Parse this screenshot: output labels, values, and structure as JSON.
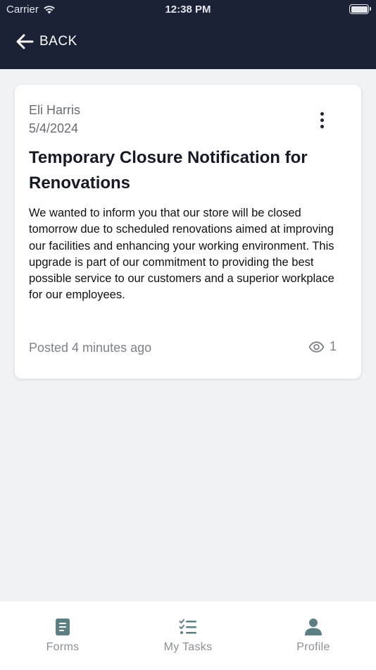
{
  "status_bar": {
    "carrier": "Carrier",
    "time": "12:38 PM"
  },
  "header": {
    "back_label": "BACK"
  },
  "post": {
    "author": "Eli Harris",
    "date": "5/4/2024",
    "title": "Temporary Closure Notification for Renovations",
    "body": "We wanted to inform you that our store will be closed tomorrow due to scheduled renovations aimed at improving our facilities and enhancing your working environment. This upgrade is part of our commitment to providing the best possible service to our customers and a superior workplace for our employees.",
    "posted": "Posted 4 minutes ago",
    "views": "1"
  },
  "tabs": [
    {
      "label": "Forms",
      "icon": "document-icon"
    },
    {
      "label": "My Tasks",
      "icon": "checklist-icon"
    },
    {
      "label": "Profile",
      "icon": "person-icon"
    }
  ],
  "colors": {
    "header_bg": "#1b2236",
    "background": "#f1f2f6",
    "icon_teal": "#5d7e82"
  }
}
